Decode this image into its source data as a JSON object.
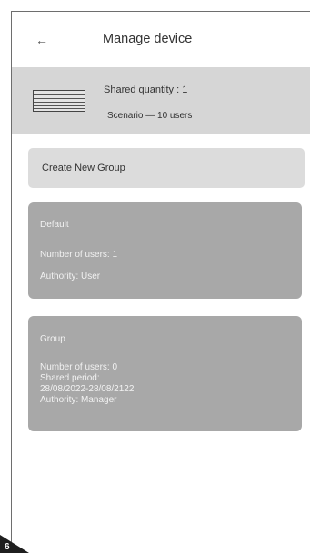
{
  "header": {
    "back_icon": "←",
    "title": "Manage device"
  },
  "device": {
    "icon": "blind-icon",
    "shared_quantity": "Shared quantity : 1",
    "scenario": "Scenario — 10 users"
  },
  "create_group": {
    "label": "Create New Group"
  },
  "groups": [
    {
      "name": "Default",
      "users": "Number of users: 1",
      "authority": "Authority: User"
    },
    {
      "name": "Group",
      "users": "Number of users: 0",
      "shared_period_label": "Shared period:",
      "shared_period": "28/08/2022-28/08/2122",
      "authority": "Authority: Manager"
    }
  ],
  "page_number": "6",
  "colors": {
    "banner": "#d6d6d6",
    "button": "#dcdcdc",
    "card": "#a8a8a8",
    "card_text": "#f2f2f2"
  }
}
